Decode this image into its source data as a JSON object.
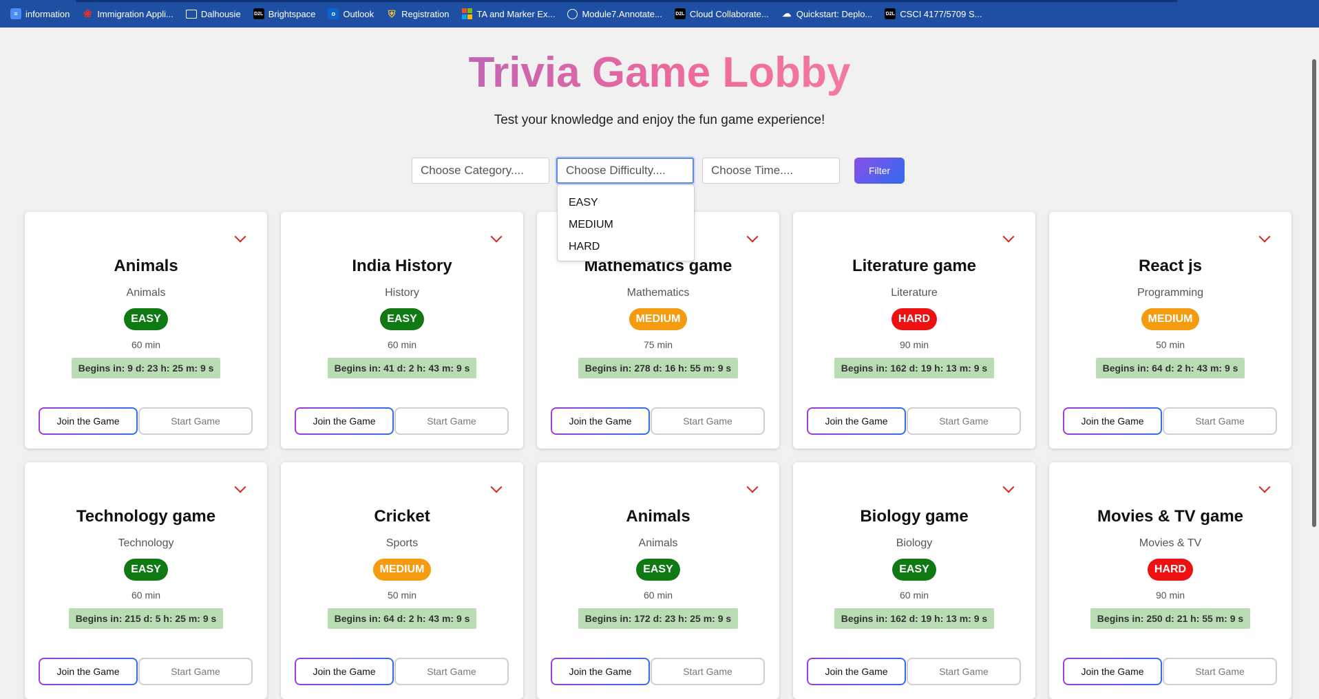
{
  "bookmarks": [
    {
      "label": "information",
      "icon": "doc-icon"
    },
    {
      "label": "Immigration Appli...",
      "icon": "maple-leaf-icon"
    },
    {
      "label": "Dalhousie",
      "icon": "folder-icon"
    },
    {
      "label": "Brightspace",
      "icon": "d2l-icon"
    },
    {
      "label": "Outlook",
      "icon": "outlook-icon"
    },
    {
      "label": "Registration",
      "icon": "shield-icon"
    },
    {
      "label": "TA and Marker Ex...",
      "icon": "microsoft-icon"
    },
    {
      "label": "Module7.Annotate...",
      "icon": "globe-icon"
    },
    {
      "label": "Cloud Collaborate...",
      "icon": "d2l-icon"
    },
    {
      "label": "Quickstart: Deplo...",
      "icon": "google-cloud-icon"
    },
    {
      "label": "CSCI 4177/5709 S...",
      "icon": "d2l-icon"
    }
  ],
  "header": {
    "title": "Trivia Game Lobby",
    "subtitle": "Test your knowledge and enjoy the fun game experience!"
  },
  "filters": {
    "category_placeholder": "Choose Category....",
    "difficulty_placeholder": "Choose Difficulty....",
    "time_placeholder": "Choose Time....",
    "button_label": "Filter",
    "difficulty_options": [
      "EASY",
      "MEDIUM",
      "HARD"
    ]
  },
  "colors": {
    "EASY": "#0f7a14",
    "MEDIUM": "#f59b0f",
    "HARD": "#ee1111",
    "timer_bg": "#b9dcb4",
    "bookmarks_bar": "#1f4fa3"
  },
  "card_labels": {
    "join": "Join the Game",
    "start": "Start Game"
  },
  "games": [
    {
      "title": "Animals",
      "category": "Animals",
      "difficulty": "EASY",
      "duration": "60 min",
      "begins": "Begins in: 9 d: 23 h: 25 m: 9 s"
    },
    {
      "title": "India History",
      "category": "History",
      "difficulty": "EASY",
      "duration": "60 min",
      "begins": "Begins in: 41 d: 2 h: 43 m: 9 s"
    },
    {
      "title": "Mathematics game",
      "category": "Mathematics",
      "difficulty": "MEDIUM",
      "duration": "75 min",
      "begins": "Begins in: 278 d: 16 h: 55 m: 9 s"
    },
    {
      "title": "Literature game",
      "category": "Literature",
      "difficulty": "HARD",
      "duration": "90 min",
      "begins": "Begins in: 162 d: 19 h: 13 m: 9 s"
    },
    {
      "title": "React js",
      "category": "Programming",
      "difficulty": "MEDIUM",
      "duration": "50 min",
      "begins": "Begins in: 64 d: 2 h: 43 m: 9 s"
    },
    {
      "title": "Technology game",
      "category": "Technology",
      "difficulty": "EASY",
      "duration": "60 min",
      "begins": "Begins in: 215 d: 5 h: 25 m: 9 s"
    },
    {
      "title": "Cricket",
      "category": "Sports",
      "difficulty": "MEDIUM",
      "duration": "50 min",
      "begins": "Begins in: 64 d: 2 h: 43 m: 9 s"
    },
    {
      "title": "Animals",
      "category": "Animals",
      "difficulty": "EASY",
      "duration": "60 min",
      "begins": "Begins in: 172 d: 23 h: 25 m: 9 s"
    },
    {
      "title": "Biology game",
      "category": "Biology",
      "difficulty": "EASY",
      "duration": "60 min",
      "begins": "Begins in: 162 d: 19 h: 13 m: 9 s"
    },
    {
      "title": "Movies & TV game",
      "category": "Movies & TV",
      "difficulty": "HARD",
      "duration": "90 min",
      "begins": "Begins in: 250 d: 21 h: 55 m: 9 s"
    }
  ]
}
